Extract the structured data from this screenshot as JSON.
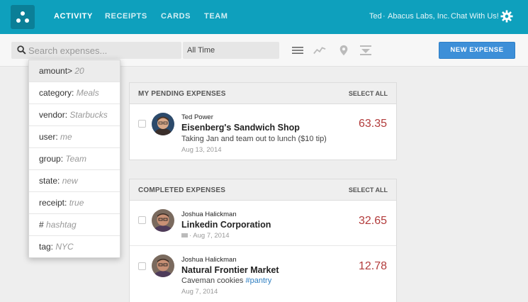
{
  "nav": {
    "items": [
      {
        "label": "ACTIVITY",
        "active": true
      },
      {
        "label": "RECEIPTS",
        "active": false
      },
      {
        "label": "CARDS",
        "active": false
      },
      {
        "label": "TEAM",
        "active": false
      }
    ],
    "user": "Ted",
    "separator": "·",
    "company": "Abacus Labs, Inc.",
    "chat": "Chat With Us!"
  },
  "toolbar": {
    "search_placeholder": "Search expenses...",
    "date_filter": "All Time",
    "new_expense_label": "NEW EXPENSE"
  },
  "pending": {
    "title": "MY PENDING EXPENSES",
    "select_all": "SELECT ALL",
    "items": [
      {
        "submitter": "Ted Power",
        "merchant": "Eisenberg's Sandwich Shop",
        "description": "Taking Jan and team out to lunch ($10 tip)",
        "date": "Aug 13, 2014",
        "amount": "63.35"
      }
    ]
  },
  "completed": {
    "title": "COMPLETED EXPENSES",
    "select_all": "SELECT ALL",
    "items": [
      {
        "submitter": "Joshua Halickman",
        "merchant": "Linkedin Corporation",
        "date": "· Aug 7, 2014",
        "amount": "32.65"
      },
      {
        "submitter": "Joshua Halickman",
        "merchant": "Natural Frontier Market",
        "description": "Caveman cookies ",
        "tag": "#pantry",
        "date": "Aug 7, 2014",
        "amount": "12.78"
      }
    ]
  },
  "search_suggestions": [
    {
      "key": "amount>",
      "example": " 20"
    },
    {
      "key": "category:",
      "example": " Meals"
    },
    {
      "key": "vendor:",
      "example": " Starbucks"
    },
    {
      "key": "user:",
      "example": " me"
    },
    {
      "key": "group:",
      "example": " Team"
    },
    {
      "key": "state:",
      "example": " new"
    },
    {
      "key": "receipt:",
      "example": " true"
    },
    {
      "key": "#",
      "example": " hashtag"
    },
    {
      "key": "tag:",
      "example": " NYC"
    }
  ],
  "colors": {
    "nav_bg": "#0ea0bd",
    "accent_button": "#3d8fd8",
    "amount": "#b23b3b",
    "tag": "#2f7fc1"
  },
  "icons": [
    "logo-icon",
    "gear-icon",
    "search-icon",
    "list-view-icon",
    "trend-icon",
    "map-pin-icon",
    "download-icon",
    "card-icon"
  ]
}
